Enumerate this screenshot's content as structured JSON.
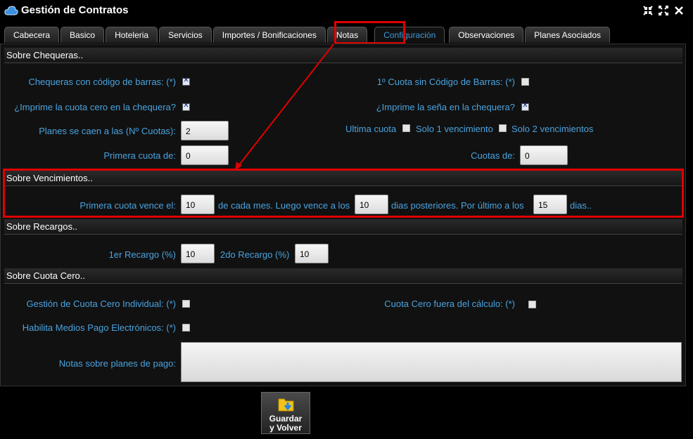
{
  "window": {
    "title": "Gestión de Contratos",
    "icons": [
      "cloud-icon",
      "collapse-icon",
      "expand-icon",
      "close-icon"
    ]
  },
  "tabs": [
    {
      "label": "Cabecera"
    },
    {
      "label": "Basico"
    },
    {
      "label": "Hoteleria"
    },
    {
      "label": "Servicios"
    },
    {
      "label": "Importes / Bonificaciones"
    },
    {
      "label": "Notas"
    },
    {
      "label": "Configuración",
      "active": true
    },
    {
      "label": "Observaciones"
    },
    {
      "label": "Planes Asociados"
    }
  ],
  "chequeras": {
    "header": "Sobre Chequeras..",
    "codigo_barras_label": "Chequeras con código de barras: (*)",
    "codigo_barras_checked": true,
    "cuota1_sin_codigo_label": "1º Cuota sin Código de Barras: (*)",
    "cuota1_sin_codigo_checked": false,
    "imprime_cuota_cero_label": "¿Imprime la cuota cero en la chequera?",
    "imprime_cuota_cero_checked": true,
    "imprime_sena_label": "¿Imprime la seña en la chequera?",
    "imprime_sena_checked": true,
    "planes_caen_label": "Planes se caen a las (Nº Cuotas):",
    "planes_caen_value": "2",
    "ultima_cuota_label": "Ultima cuota",
    "solo1_label": "Solo 1 vencimiento",
    "solo2_label": "Solo 2 vencimientos",
    "primera_cuota_label": "Primera cuota de:",
    "primera_cuota_value": "0",
    "cuotas_de_label": "Cuotas de:",
    "cuotas_de_value": "0"
  },
  "vencimientos": {
    "header": "Sobre Vencimientos..",
    "primera_vence_label": "Primera cuota vence el:",
    "primera_vence_value": "10",
    "cada_mes_text": "de cada mes. Luego vence a los",
    "luego_value": "10",
    "dias_post_text": "dias posteriores. Por último a los",
    "ultimo_value": "15",
    "dias_text": "dias.."
  },
  "recargos": {
    "header": "Sobre Recargos..",
    "recargo1_label": "1er Recargo (%)",
    "recargo1_value": "10",
    "recargo2_label": "2do Recargo (%)",
    "recargo2_value": "10"
  },
  "cuota_cero": {
    "header": "Sobre Cuota Cero..",
    "gestion_label": "Gestión de Cuota Cero Individual: (*)",
    "fuera_calculo_label": "Cuota Cero fuera del cálculo: (*)",
    "habilita_label": "Habilita Medios Pago Electrónicos: (*)",
    "notas_label": "Notas sobre planes de pago:",
    "notas_value": ""
  },
  "save_button": {
    "line1": "Guardar",
    "line2": "y Volver",
    "icon": "folder-save-icon"
  },
  "colors": {
    "label_blue": "#4aa3df",
    "highlight_red": "#e00000",
    "background": "#000000"
  }
}
